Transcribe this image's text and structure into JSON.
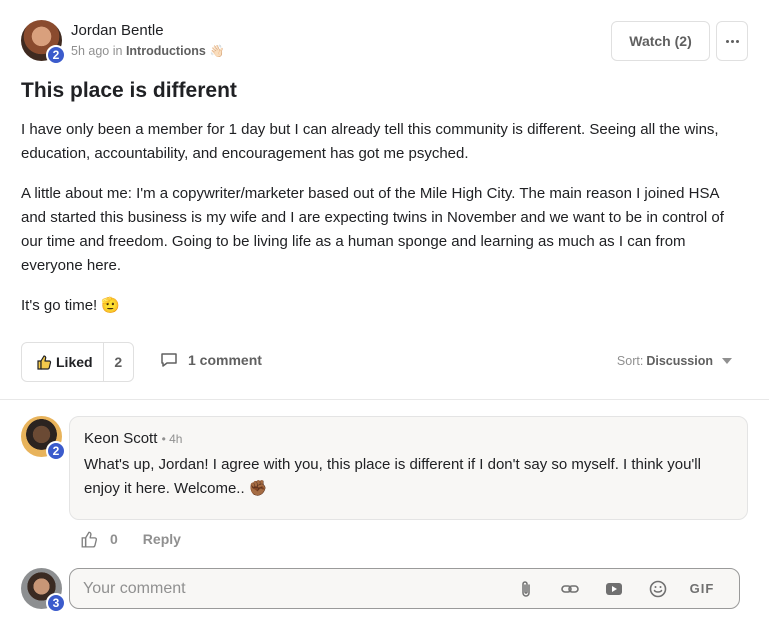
{
  "post": {
    "author_name": "Jordan Bentle",
    "author_level": "2",
    "time_ago": "5h ago",
    "in_word": "in",
    "category": "Introductions",
    "category_emoji": "👋🏻",
    "title": "This place is different",
    "paragraphs": [
      "I have only been a member for 1 day but I can already tell this community is different. Seeing all the wins, education, accountability, and encouragement has got me psyched.",
      "A little about me: I'm a copywriter/marketer based out of the Mile High City. The main reason I joined HSA and started this business is my wife and I are expecting twins in November and we want to be in control of our time and freedom. Going to be living life as a human sponge and learning as much as I can from everyone here.",
      "It's go time! 🫡"
    ],
    "watch_label": "Watch (2)",
    "liked_label": "Liked",
    "like_count": "2",
    "comment_count_label": "1 comment",
    "sort_prefix": "Sort:",
    "sort_value": "Discussion"
  },
  "comment": {
    "author_name": "Keon Scott",
    "author_level": "2",
    "time": "• 4h",
    "text": "What's up, Jordan! I agree with you, this place is different if I don't say so myself. I think you'll enjoy it here. Welcome.. ✊🏾",
    "like_count": "0",
    "reply_label": "Reply"
  },
  "composer": {
    "user_level": "3",
    "placeholder": "Your comment",
    "gif_label": "GIF"
  },
  "colors": {
    "badge": "#3b5bcc",
    "muted": "#909090",
    "card_bg": "#f8f7f5"
  },
  "icons": [
    "ellipsis-icon",
    "thumbs-up-icon",
    "comment-bubble-icon",
    "caret-down-icon",
    "paperclip-icon",
    "link-icon",
    "video-icon",
    "emoji-icon",
    "gif-icon"
  ]
}
